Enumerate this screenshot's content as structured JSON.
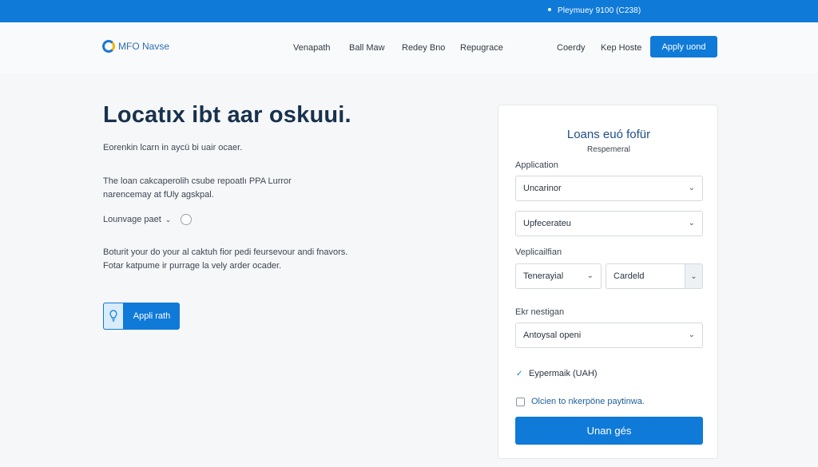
{
  "topbar": {
    "phone": "Pleymuey 9100 (C238)"
  },
  "header": {
    "logo_text": "MFO Navse",
    "nav": [
      "Venapath",
      "Ball Maw",
      "Redey Bno",
      "Repugrace"
    ],
    "right_links": [
      "Coerdy",
      "Kep Hoste"
    ],
    "apply_button": "Apply uond"
  },
  "hero": {
    "headline": "Locatıx ibt aar oskuui.",
    "subtitle": "Eorenkin lcarn in aycü bi uair ocaer.",
    "para1": [
      "The loan cakcaperolih csube repoatlı PPA Lurror",
      "narencemay at fUly agskpal."
    ],
    "language_label": "Lounvage paet",
    "para2": [
      "Boturit your do your al caktuh fior pedi feursevour andi fnavors.",
      "Fotar katpume ir purrage la vely arder ocader."
    ],
    "apply_path_label": "Appli rath"
  },
  "card": {
    "title": "Loans euó fofür",
    "subtitle": "Respemeral",
    "section1_label": "Application",
    "select1": "Uncarinor",
    "select2": "Upfecerateu",
    "section2_label": "Veplicailfian",
    "select3": "Tenerayial",
    "select4": "Cardeld",
    "section3_label": "Ekr nestigan",
    "select5": "Antoysal openi",
    "checked_option": "Eypermaik (UAH)",
    "unchecked_option": "Olcien to nkerpöne paytinwa.",
    "submit": "Unan gés"
  },
  "colors": {
    "primary": "#0f7ad8",
    "headline": "#18324d",
    "link": "#1d4e86"
  }
}
